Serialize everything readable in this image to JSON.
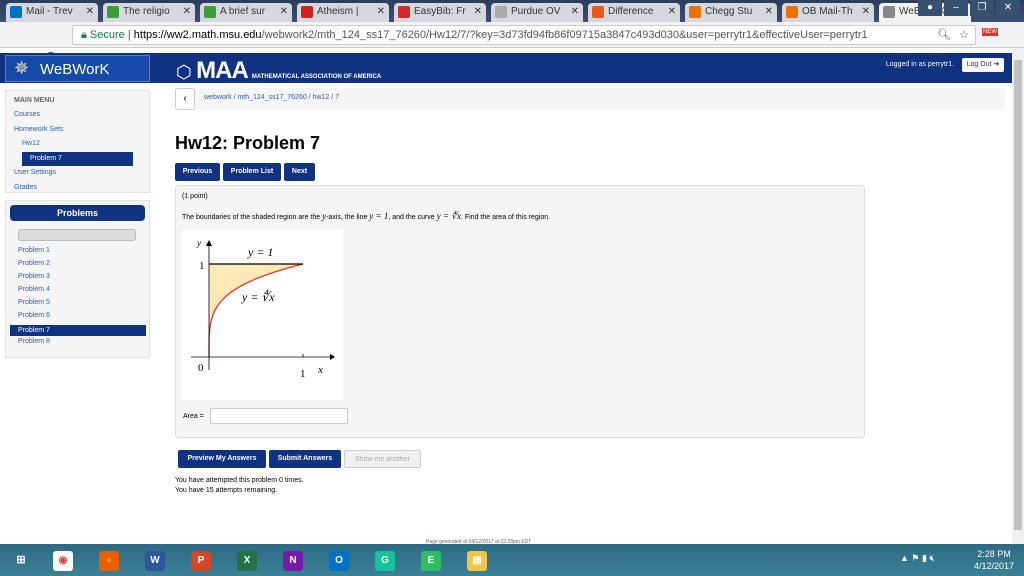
{
  "browser": {
    "tabs": [
      {
        "label": "Mail - Trev",
        "color": "#0072c6"
      },
      {
        "label": "The religio",
        "color": "#3a9f3a"
      },
      {
        "label": "A brief sur",
        "color": "#3a9f3a"
      },
      {
        "label": "Atheism |",
        "color": "#cc2222"
      },
      {
        "label": "EasyBib: Fr",
        "color": "#d4282f"
      },
      {
        "label": "Purdue OV",
        "color": "#aaaaaa"
      },
      {
        "label": "Difference",
        "color": "#e25a1c"
      },
      {
        "label": "Chegg Stu",
        "color": "#eb7100"
      },
      {
        "label": "OB Mail-Th",
        "color": "#eb7100"
      },
      {
        "label": "WeBWorK",
        "color": "#888888",
        "active": true
      }
    ],
    "secure_label": "Secure",
    "url_host": "https://ww2.math.msu.edu",
    "url_path": "/webwork2/mth_124_ss17_76260/Hw12/7/?key=3d73fd94fb86f09715a3847c493d030&user=perrytr1&effectiveUser=perrytr1",
    "extension_badge": "NEW"
  },
  "header": {
    "logo": "WeBWorK",
    "maa": "MAA",
    "maa_sub": "MATHEMATICAL ASSOCIATION OF AMERICA",
    "logged_in": "Logged in as perrytr1.",
    "logout": "Log Out"
  },
  "menu": {
    "title": "MAIN MENU",
    "items": [
      "Courses",
      "Homework Sets",
      "Hw12",
      "Problem 7",
      "User Settings",
      "Grades"
    ]
  },
  "problems": {
    "title": "Problems",
    "items": [
      "Problem 1",
      "Problem 2",
      "Problem 3",
      "Problem 4",
      "Problem 5",
      "Problem 6",
      "Problem 7",
      "Problem 8"
    ],
    "selected": 6
  },
  "breadcrumb": "webwork / mth_124_ss17_76260 / hw12 / 7",
  "title": "Hw12: Problem 7",
  "nav_buttons": [
    "Previous",
    "Problem List",
    "Next"
  ],
  "problem": {
    "points": "(1 point)",
    "text_1": "The boundaries of the shaded region are the ",
    "m_y": "y",
    "text_2": "-axis, the line ",
    "m_line": "y = 1",
    "text_3": ", and the curve ",
    "m_curve": "y = ∜x",
    "text_4": ". Find the area of this region.",
    "graph": {
      "y_axis": "y",
      "x_axis": "x",
      "line_label": "y = 1",
      "curve_label": "y = ∜x",
      "origin": "0",
      "tick_x": "1",
      "tick_y": "1",
      "shade_color": "#fde9b8",
      "curve_color": "#e8322a"
    },
    "area_label": "Area =",
    "area_value": ""
  },
  "actions": [
    "Preview My Answers",
    "Submit Answers",
    "Show me another"
  ],
  "attempts": [
    "You have attempted this problem 0 times.",
    "You have 15 attempts remaining."
  ],
  "footer": "Page generated at 04/12/2017 at 02:28pm EDT",
  "taskbar": {
    "apps": [
      "chrome",
      "firefox",
      "word",
      "powerpoint",
      "excel",
      "onenote",
      "outlook",
      "grammarly",
      "evernote",
      "file-explorer"
    ],
    "time": "2:28 PM",
    "date": "4/12/2017"
  }
}
